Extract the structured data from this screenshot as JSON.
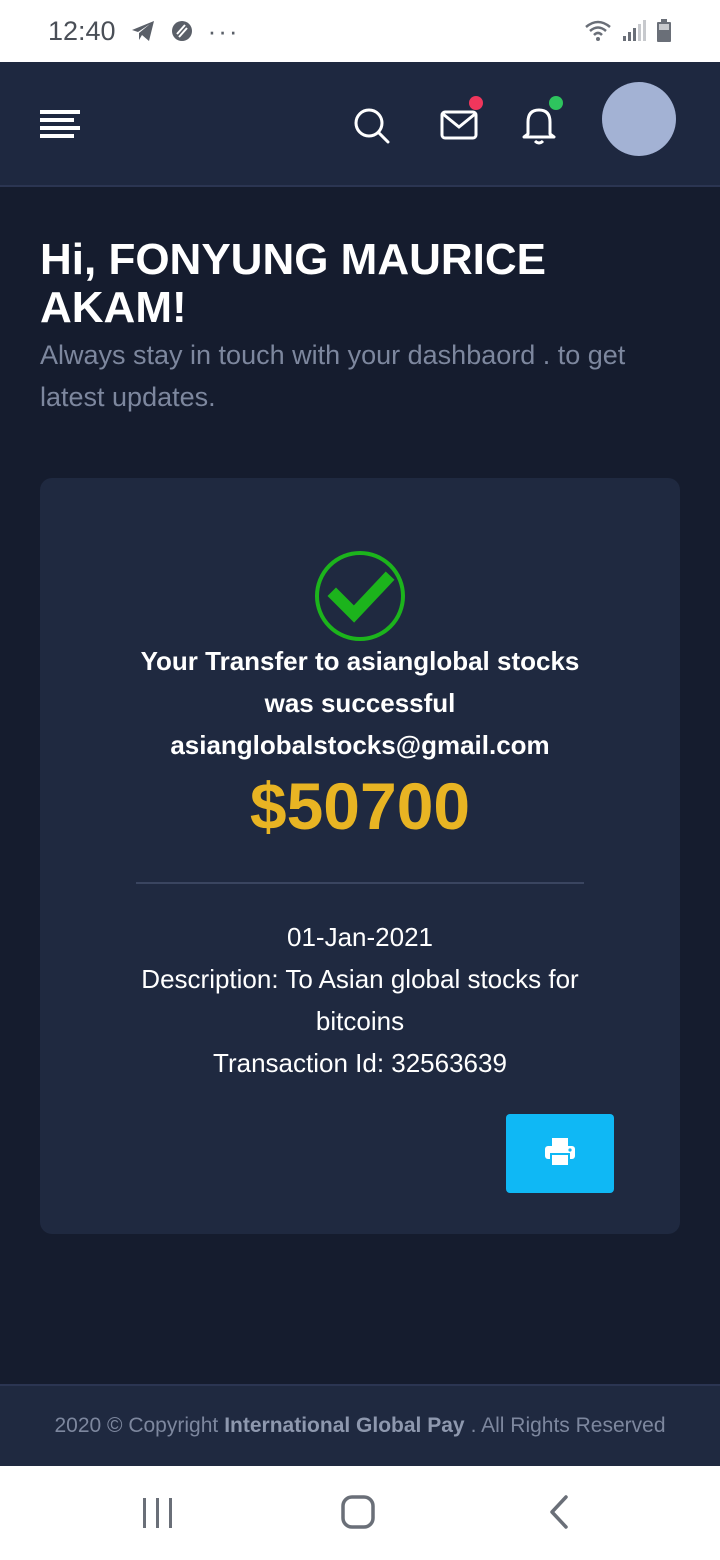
{
  "status_bar": {
    "time": "12:40",
    "dots": "···"
  },
  "nav": {
    "menu_icon": "hamburger-icon",
    "search_icon": "search-icon",
    "mail_icon": "mail-icon",
    "bell_icon": "bell-icon",
    "mail_badge_color": "#f0365c",
    "bell_badge_color": "#2ec45e"
  },
  "greeting": {
    "title": "Hi, FONYUNG MAURICE AKAM!",
    "subtitle": "Always stay in touch with your dashbaord . to get latest updates."
  },
  "receipt": {
    "status_icon": "check-circle-icon",
    "message_line1": "Your Transfer to asianglobal stocks",
    "message_line2": "was successful",
    "email": "asianglobalstocks@gmail.com",
    "amount": "$50700",
    "date": "01-Jan-2021",
    "description": "Description: To Asian global stocks for bitcoins",
    "transaction_id": "Transaction Id: 32563639",
    "print_icon": "printer-icon",
    "accent_color": "#e8b423",
    "success_color": "#1cb41c",
    "button_color": "#0fb8f5"
  },
  "footer": {
    "prefix": "2020 © Copyright",
    "brand": "International Global Pay",
    "suffix": ". All Rights Reserved"
  }
}
